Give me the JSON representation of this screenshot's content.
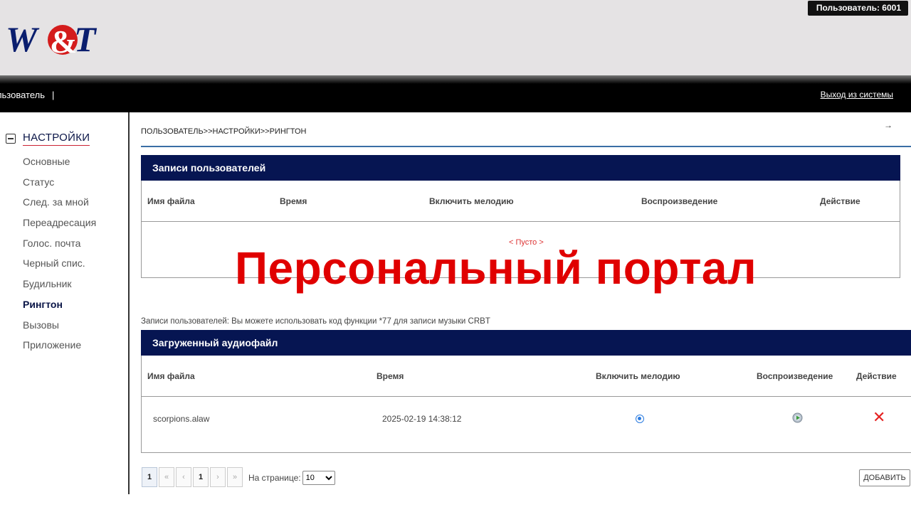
{
  "header": {
    "logo_text": "W&T",
    "user_badge": "Пользователь:  6001"
  },
  "navbar": {
    "user_label": "ользователь",
    "separator": "|",
    "logout": "Выход из системы"
  },
  "sidebar": {
    "title": "НАСТРОЙКИ",
    "items": [
      {
        "label": "Основные"
      },
      {
        "label": "Статус"
      },
      {
        "label": "След. за мной"
      },
      {
        "label": "Переадресация"
      },
      {
        "label": "Голос. почта"
      },
      {
        "label": "Черный спис."
      },
      {
        "label": "Будильник"
      },
      {
        "label": "Рингтон",
        "active": true
      },
      {
        "label": "Вызовы"
      },
      {
        "label": "Приложение"
      }
    ]
  },
  "main": {
    "breadcrumb": "ПОЛЬЗОВАТЕЛЬ>>НАСТРОЙКИ>>РИНГТОН",
    "arrow": "→",
    "user_records": {
      "title": "Записи пользователей",
      "columns": [
        "Имя файла",
        "Время",
        "Включить мелодию",
        "Воспроизведение",
        "Действие"
      ],
      "empty_text": "< Пусто >"
    },
    "overlay_title": "Персональный портал",
    "note": "Записи пользователей: Вы можете использовать код функции *77 для записи музыки CRBT",
    "uploaded": {
      "title": "Загруженный аудиофайл",
      "columns": [
        "Имя файла",
        "Время",
        "Включить мелодию",
        "Воспроизведение",
        "Действие"
      ],
      "rows": [
        {
          "file": "scorpions.alaw",
          "time": "2025-02-19 14:38:12",
          "enabled": true
        }
      ]
    },
    "pagination": {
      "buttons": [
        "1",
        "«",
        "‹",
        "1",
        "›",
        "»"
      ],
      "per_page_label": "На странице:",
      "per_page_value": "10"
    },
    "add_button": "ДОБАВИТЬ"
  }
}
